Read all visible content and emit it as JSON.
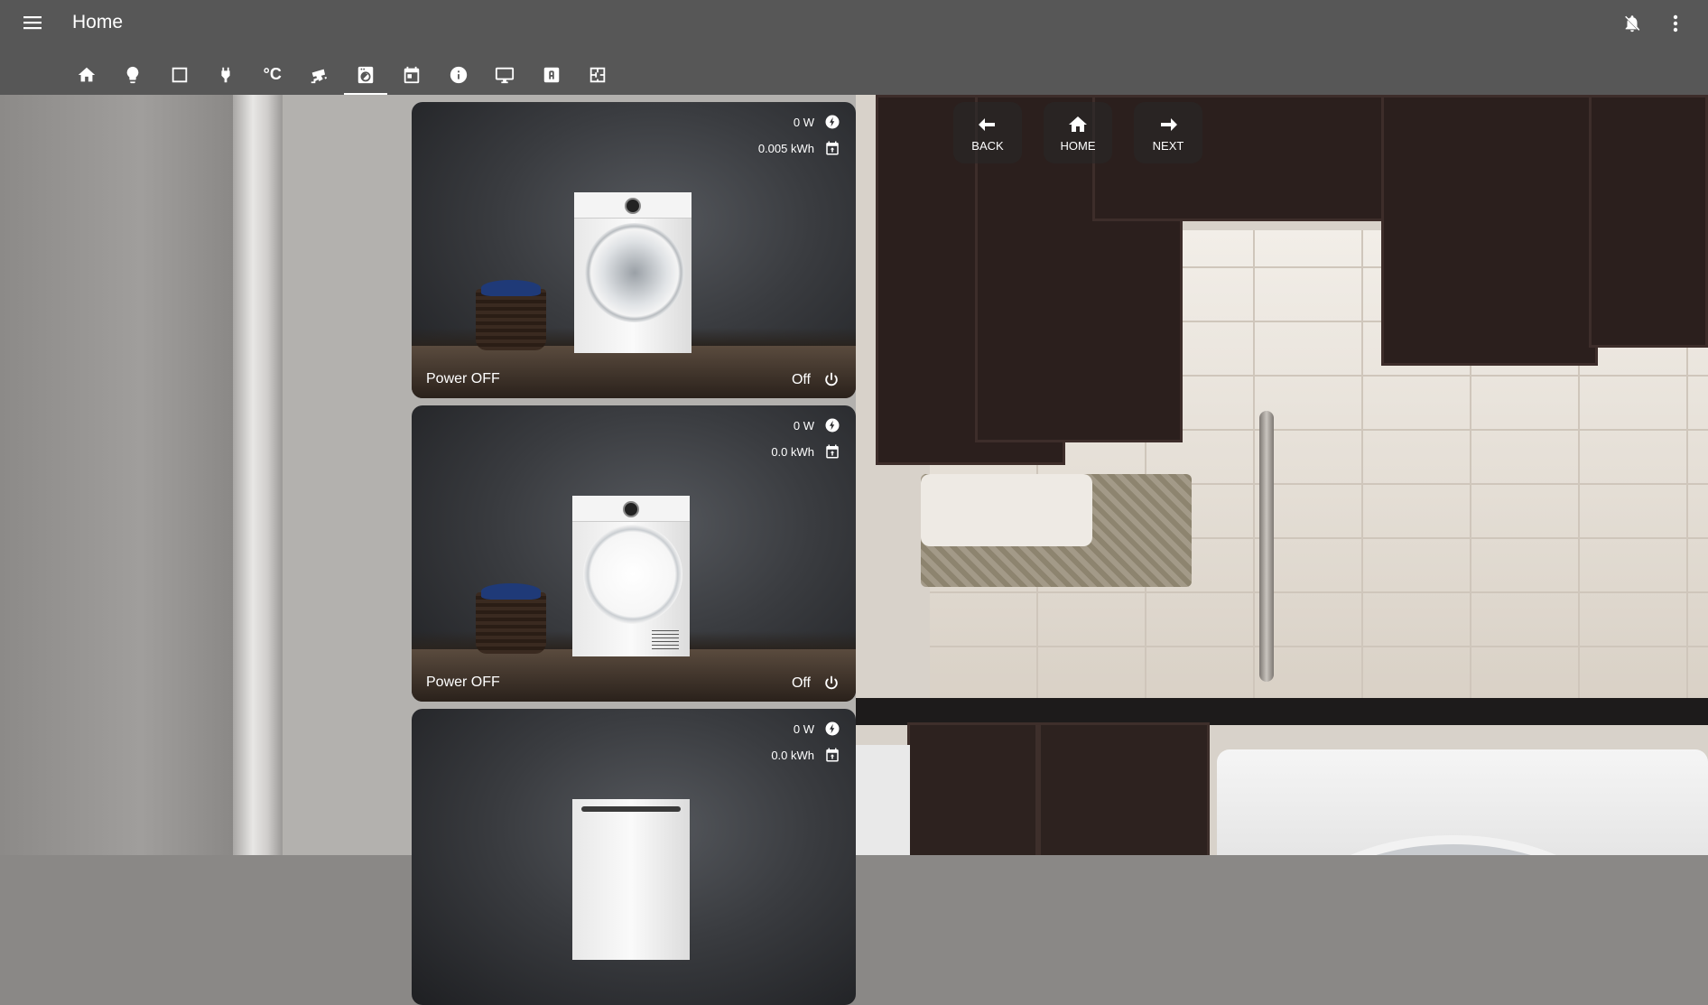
{
  "app": {
    "title": "Home"
  },
  "header": {
    "menu_icon": "menu-icon",
    "notifications_icon": "bell-icon",
    "overflow_icon": "dots-vertical-icon"
  },
  "tabs": [
    {
      "icon": "home-icon",
      "active": false
    },
    {
      "icon": "lightbulb-icon",
      "active": false
    },
    {
      "icon": "square-icon",
      "active": false
    },
    {
      "icon": "power-plug-icon",
      "active": false
    },
    {
      "icon": "celsius-icon",
      "text": "°C",
      "active": false
    },
    {
      "icon": "cctv-icon",
      "active": false
    },
    {
      "icon": "washing-machine-icon",
      "active": true
    },
    {
      "icon": "calendar-icon",
      "active": false
    },
    {
      "icon": "info-icon",
      "active": false
    },
    {
      "icon": "monitor-icon",
      "active": false
    },
    {
      "icon": "alpha-a-box-icon",
      "active": false
    },
    {
      "icon": "floor-plan-icon",
      "active": false
    }
  ],
  "nav_buttons": {
    "back": "BACK",
    "home": "HOME",
    "next": "NEXT"
  },
  "cards": [
    {
      "power": "0 W",
      "energy": "0.005 kWh",
      "label": "Power OFF",
      "state": "Off",
      "appliance": "washing-machine"
    },
    {
      "power": "0 W",
      "energy": "0.0 kWh",
      "label": "Power OFF",
      "state": "Off",
      "appliance": "dryer"
    },
    {
      "power": "0 W",
      "energy": "0.0 kWh",
      "appliance": "dishwasher"
    }
  ],
  "colors": {
    "header_bg": "#575757",
    "text": "#ffffff"
  }
}
